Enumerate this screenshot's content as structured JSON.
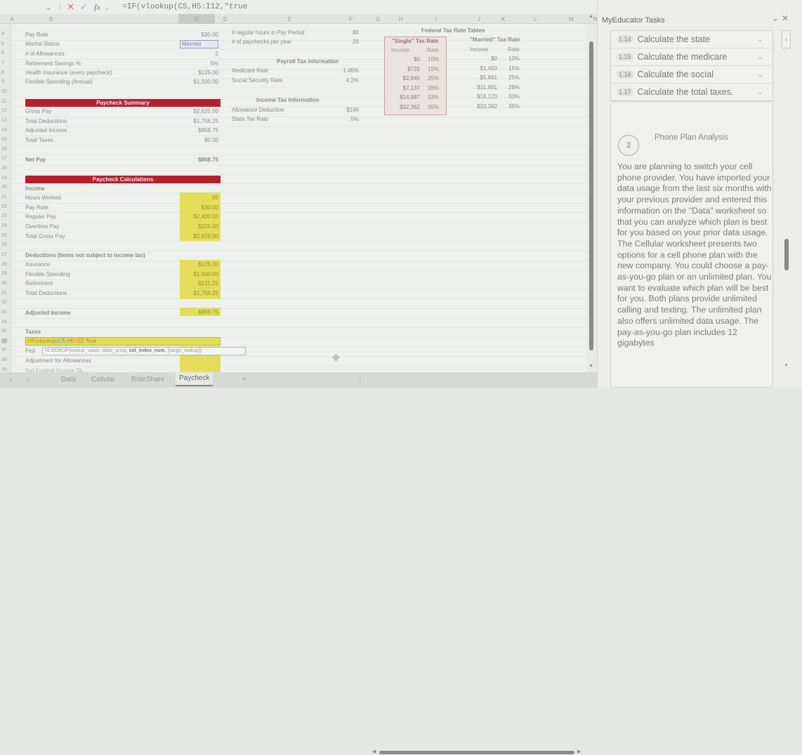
{
  "formula_bar": {
    "cancel_icon": "x-icon",
    "enter_icon": "check-icon",
    "fx_label": "fx",
    "formula": "=IF(vlookup(C5,H5:I12,\"true"
  },
  "columns": [
    "A",
    "B",
    "C",
    "D",
    "E",
    "F",
    "G",
    "H",
    "I",
    "J",
    "K",
    "L",
    "M",
    "N"
  ],
  "selected_column": "C",
  "rows": [
    "4",
    "5",
    "6",
    "7",
    "8",
    "9",
    "10",
    "11",
    "12",
    "13",
    "14",
    "15",
    "16",
    "17",
    "18",
    "19",
    "20",
    "21",
    "22",
    "23",
    "24",
    "25",
    "26",
    "27",
    "28",
    "29",
    "30",
    "31",
    "32",
    "33",
    "34",
    "35",
    "36",
    "37",
    "38",
    "39"
  ],
  "inputs": {
    "pay_rate": {
      "label": "Pay Rate",
      "value": "$30.00"
    },
    "marital_status": {
      "label": "Marital Status",
      "value": "Married"
    },
    "allowances": {
      "label": "# of Allowances",
      "value": "2"
    },
    "retirement": {
      "label": "Retirement Savings %",
      "value": "5%"
    },
    "health": {
      "label": "Health Insurance (every paycheck)",
      "value": "$125.00"
    },
    "flex": {
      "label": "Flexible Spending (Annual)",
      "value": "$1,500.00"
    }
  },
  "summary": {
    "title": "Paycheck Summary",
    "gross_pay": {
      "label": "Gross Pay",
      "value": "$2,625.00"
    },
    "total_deductions": {
      "label": "Total Deductions",
      "value": "$1,756.25"
    },
    "adjusted_income": {
      "label": "Adjusted Income",
      "value": "$868.75"
    },
    "total_taxes": {
      "label": "Total Taxes",
      "value": "$0.00"
    },
    "net_pay": {
      "label": "Net Pay",
      "value": "$868.75"
    }
  },
  "params": {
    "regular_hours": {
      "label": "# regular hours in Pay Period",
      "value": "80"
    },
    "paychecks": {
      "label": "# of paychecks per year",
      "value": "26"
    },
    "payroll_title": "Payroll Tax information",
    "medicare": {
      "label": "Medicare Rate",
      "value": "1.45%"
    },
    "social_security": {
      "label": "Social Security Rate",
      "value": "4.2%"
    },
    "income_title": "Income Tax Information",
    "allowance_deduction": {
      "label": "Allowance Deduction",
      "value": "$146"
    },
    "state_tax": {
      "label": "State Tax Rate",
      "value": "5%"
    }
  },
  "federal": {
    "title": "Federal Tax Rate Tables",
    "single": {
      "title": "\"Single\" Tax Rate",
      "headers": [
        "Income",
        "Rate"
      ],
      "rows": [
        [
          "$0",
          "10%"
        ],
        [
          "$725",
          "15%"
        ],
        [
          "$2,945",
          "25%"
        ],
        [
          "$7,137",
          "28%"
        ],
        [
          "$14,887",
          "33%"
        ],
        [
          "$32,362",
          "35%"
        ]
      ]
    },
    "married": {
      "title": "\"Married\" Tax Rate",
      "headers": [
        "Income",
        "Rate"
      ],
      "rows": [
        [
          "$0",
          "10%"
        ],
        [
          "$1,450",
          "15%"
        ],
        [
          "$5,891",
          "25%"
        ],
        [
          "$11,891",
          "28%"
        ],
        [
          "$18,120",
          "33%"
        ],
        [
          "$32,362",
          "35%"
        ]
      ]
    }
  },
  "calculations": {
    "title": "Paycheck Calculations",
    "income_label": "Income",
    "income_rows": [
      {
        "label": "Hours Worked",
        "value": "85"
      },
      {
        "label": "Pay Rate",
        "value": "$30.00"
      },
      {
        "label": "Regular Pay",
        "value": "$2,400.00"
      },
      {
        "label": "Overtime Pay",
        "value": "$225.00"
      },
      {
        "label": "Total Gross Pay",
        "value": "$2,625.00"
      }
    ],
    "deductions_label": "Deductions (Items not subject to income tax)",
    "deduction_rows": [
      {
        "label": "Insurance",
        "value": "$125.00"
      },
      {
        "label": "Flexible Spending",
        "value": "$1,500.00"
      },
      {
        "label": "Retirement",
        "value": "$131.25"
      },
      {
        "label": "Total Deductions",
        "value": "$1,756.25"
      }
    ],
    "adjusted_income": {
      "label": "Adjusted Income",
      "value": "$868.75"
    },
    "taxes_label": "Taxes",
    "editing_formula_a": "=IF(vlookup(",
    "editing_formula_b": "C5,",
    "editing_formula_c": "H5:I12,",
    "editing_formula_d": "\"true",
    "fed_partial": "Fed",
    "adjustment_label": "Adjustment for Allowances",
    "net_fed_partial": "Net Federal Income Ta..."
  },
  "tooltip": {
    "func": "VLOOKUP(lookup_value, table_array, ",
    "bold_arg": "col_index_num",
    "rest": ", [range_lookup])"
  },
  "sheet_tabs": [
    "Data",
    "Cellular",
    "RideShare",
    "Paycheck"
  ],
  "active_tab": "Paycheck",
  "add_sheet": "+",
  "panel": {
    "title": "MyEducator Tasks",
    "tasks": [
      {
        "num": "1.14",
        "label": "Calculate the state"
      },
      {
        "num": "1.15",
        "label": "Calculate the medicare"
      },
      {
        "num": "1.16",
        "label": "Calculate the social"
      },
      {
        "num": "1.17",
        "label": "Calculate the total taxes."
      }
    ],
    "step_number": "2",
    "step_title": "Phone Plan Analysis",
    "description": "You are planning to switch your cell phone provider. You have imported your data usage from the last six months with your previous provider and entered this information on the \"Data\" worksheet so that you can analyze which plan is best for you based on your prior data usage. The Cellular worksheet presents two options for a cell phone plan with the new company. You could choose a pay-as-you-go plan or an unlimited plan. You want to evaluate which plan will be best for you. Both plans provide unlimited calling and texting. The unlimited plan also offers unlimited data usage. The pay-as-you-go plan includes 12 gigabytes"
  }
}
